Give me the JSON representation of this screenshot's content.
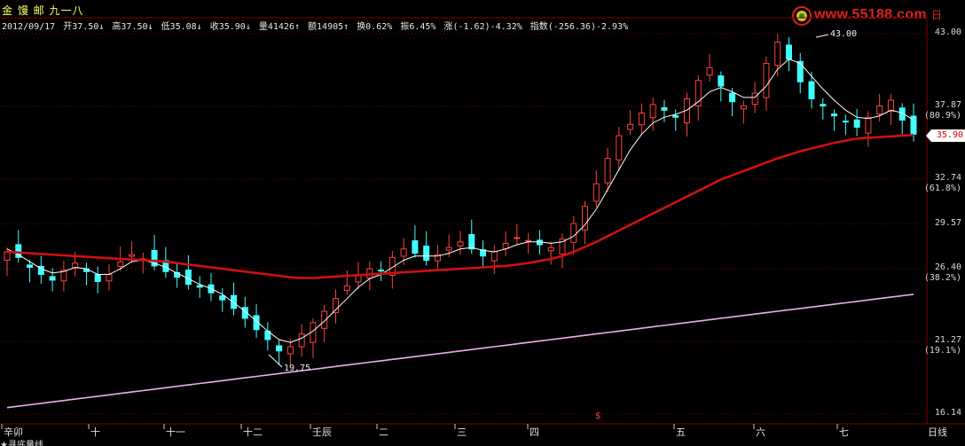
{
  "header": {
    "title": "金 馒 邮 九一八"
  },
  "quote": {
    "date": "2012/09/17",
    "open": "开37.50↓",
    "high": "高37.50↓",
    "low": "低35.08↓",
    "close": "收35.90↓",
    "volume": "量41426↑",
    "amount": "额14905↑",
    "turnover": "换0.62%",
    "amplitude": "振6.45%",
    "change": "涨(-1.62)-4.32%",
    "index": "指数(-256.36)-2.93%"
  },
  "watermark": {
    "site": "www.55188.com",
    "side": "日"
  },
  "yaxis": {
    "labels": [
      "43.00",
      "37.87",
      "32.74",
      "29.57",
      "26.40",
      "21.27",
      "16.14"
    ],
    "pct_labels": [
      "(80.9%)",
      "(61.8%)",
      "(38.2%)",
      "(19.1%)"
    ],
    "current_price": "35.90"
  },
  "annotations": {
    "high": "43.00",
    "low": "19.75"
  },
  "xaxis": {
    "labels": [
      "辛卯",
      "十",
      "十一",
      "十二",
      "壬辰",
      "二",
      "三",
      "四",
      "五",
      "六",
      "七"
    ],
    "marker": "$",
    "period": "日线"
  },
  "footer": {
    "text": "★寻底量线"
  },
  "colors": {
    "up": "#ff4040",
    "down": "#40ffff",
    "ma_short": "#ffffff",
    "ma_long": "#d01010",
    "ma_bottom": "#e8b0e8",
    "grid": "#7a0000"
  },
  "chart_data": {
    "type": "candlestick",
    "ylim": [
      16.14,
      43.0
    ],
    "grid": true,
    "series": [
      {
        "name": "close",
        "values": [
          27.6,
          27.2,
          26.5,
          26.0,
          25.6,
          26.3,
          26.8,
          26.2,
          25.5,
          26.0,
          26.9,
          27.4,
          27.1,
          26.6,
          26.2,
          25.8,
          25.3,
          25.1,
          24.7,
          24.2,
          23.6,
          22.9,
          22.1,
          21.4,
          20.6,
          20.9,
          21.8,
          22.6,
          23.4,
          24.3,
          25.2,
          26.0,
          26.4,
          26.3,
          27.2,
          27.8,
          27.5,
          27.0,
          27.4,
          27.9,
          28.3,
          27.8,
          27.3,
          27.6,
          28.2,
          28.6,
          28.4,
          28.1,
          27.9,
          28.5,
          29.6,
          30.8,
          32.4,
          34.2,
          35.8,
          36.6,
          37.4,
          38.0,
          37.6,
          37.1,
          38.4,
          39.7,
          40.6,
          39.3,
          38.2,
          37.9,
          38.8,
          40.9,
          42.4,
          41.2,
          39.6,
          38.4,
          37.9,
          37.2,
          36.8,
          36.4,
          37.1,
          37.9,
          38.3,
          36.9,
          35.9
        ]
      },
      {
        "name": "ma_short",
        "values": [
          27.8,
          27.4,
          26.9,
          26.4,
          26.1,
          26.2,
          26.5,
          26.4,
          26.0,
          26.0,
          26.4,
          26.9,
          27.0,
          26.8,
          26.5,
          26.1,
          25.7,
          25.3,
          25.0,
          24.6,
          24.0,
          23.4,
          22.7,
          22.0,
          21.4,
          21.2,
          21.5,
          22.0,
          22.7,
          23.5,
          24.3,
          25.1,
          25.7,
          26.0,
          26.5,
          27.0,
          27.3,
          27.3,
          27.3,
          27.5,
          27.8,
          27.9,
          27.7,
          27.6,
          27.8,
          28.1,
          28.3,
          28.3,
          28.2,
          28.3,
          28.7,
          29.5,
          30.6,
          32.0,
          33.4,
          34.8,
          35.9,
          36.7,
          37.1,
          37.3,
          37.6,
          38.2,
          38.9,
          39.2,
          38.9,
          38.5,
          38.5,
          39.3,
          40.5,
          41.2,
          40.9,
          40.0,
          39.1,
          38.3,
          37.6,
          37.1,
          37.0,
          37.2,
          37.6,
          37.4,
          36.9
        ]
      },
      {
        "name": "ma_long",
        "values": [
          27.6,
          27.55,
          27.5,
          27.45,
          27.4,
          27.35,
          27.3,
          27.25,
          27.2,
          27.15,
          27.1,
          27.05,
          27.0,
          26.95,
          26.9,
          26.8,
          26.7,
          26.6,
          26.5,
          26.4,
          26.3,
          26.2,
          26.1,
          26.0,
          25.9,
          25.8,
          25.75,
          25.75,
          25.8,
          25.85,
          25.9,
          25.95,
          26.0,
          26.05,
          26.1,
          26.15,
          26.2,
          26.25,
          26.3,
          26.35,
          26.4,
          26.45,
          26.5,
          26.55,
          26.6,
          26.7,
          26.8,
          26.95,
          27.1,
          27.3,
          27.6,
          27.95,
          28.3,
          28.7,
          29.1,
          29.5,
          29.9,
          30.3,
          30.7,
          31.1,
          31.5,
          31.9,
          32.3,
          32.7,
          33.0,
          33.3,
          33.6,
          33.9,
          34.2,
          34.45,
          34.7,
          34.9,
          35.1,
          35.3,
          35.45,
          35.6,
          35.65,
          35.7,
          35.75,
          35.8,
          35.85
        ]
      },
      {
        "name": "ma_bottom",
        "values": [
          16.6,
          16.7,
          16.8,
          16.9,
          17.0,
          17.1,
          17.2,
          17.3,
          17.4,
          17.5,
          17.6,
          17.7,
          17.8,
          17.9,
          18.0,
          18.1,
          18.2,
          18.3,
          18.4,
          18.5,
          18.6,
          18.7,
          18.8,
          18.9,
          19.0,
          19.1,
          19.2,
          19.3,
          19.4,
          19.5,
          19.6,
          19.7,
          19.8,
          19.9,
          20.0,
          20.1,
          20.2,
          20.3,
          20.4,
          20.5,
          20.6,
          20.7,
          20.8,
          20.9,
          21.0,
          21.1,
          21.2,
          21.3,
          21.4,
          21.5,
          21.6,
          21.7,
          21.8,
          21.9,
          22.0,
          22.1,
          22.2,
          22.3,
          22.4,
          22.5,
          22.6,
          22.7,
          22.8,
          22.9,
          23.0,
          23.1,
          23.2,
          23.3,
          23.4,
          23.5,
          23.6,
          23.7,
          23.8,
          23.9,
          24.0,
          24.1,
          24.2,
          24.3,
          24.4,
          24.5,
          24.6
        ]
      }
    ]
  }
}
